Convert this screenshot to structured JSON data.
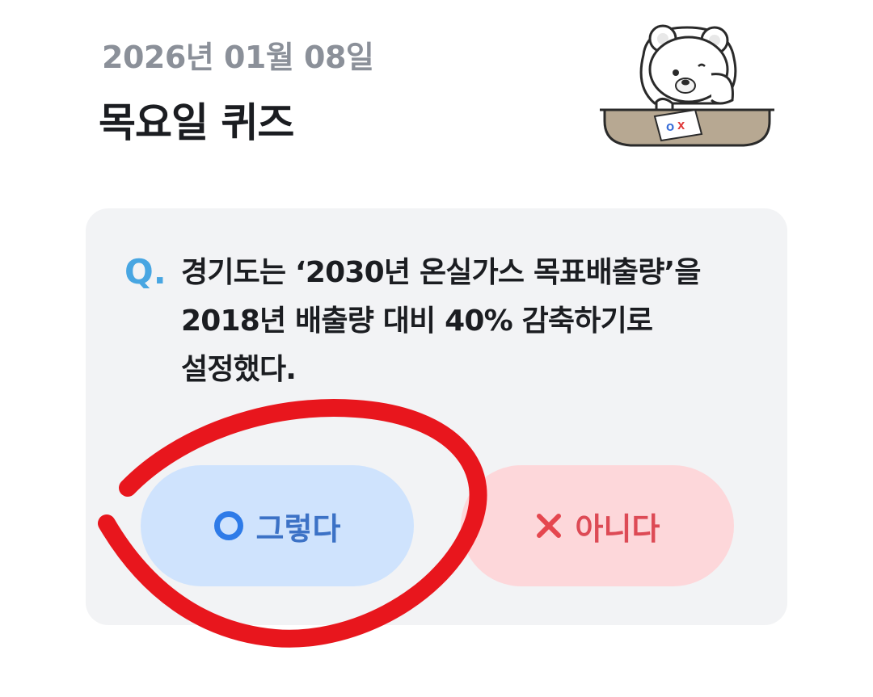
{
  "header": {
    "date": "2026년 01월 08일",
    "title": "목요일 퀴즈",
    "mascot_icon": "bear-ox-quiz-icon"
  },
  "quiz": {
    "q_label": "Q.",
    "question": "경기도는 ‘2030년 온실가스 목표배출량’을\n2018년 배출량 대비 40% 감축하기로\n설정했다."
  },
  "answers": {
    "yes_label": "그렇다",
    "no_label": "아니다",
    "yes_icon": "circle-o-icon",
    "no_icon": "x-mark-icon"
  },
  "colors": {
    "yes_bg": "#cfe3fd",
    "no_bg": "#fdd7da",
    "annotation": "#e8161d",
    "q_accent": "#48a6e2"
  },
  "annotation": {
    "type": "hand-drawn red circle",
    "target": "yes_label"
  }
}
